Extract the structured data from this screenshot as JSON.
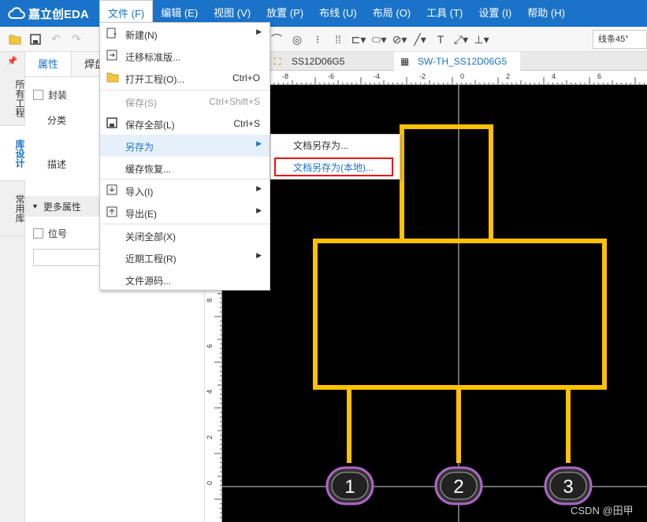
{
  "app": {
    "logo_text": "嘉立创EDA"
  },
  "menubar": {
    "items": [
      "文件 (F)",
      "编辑 (E)",
      "视图 (V)",
      "放置 (P)",
      "布线 (U)",
      "布局 (O)",
      "工具 (T)",
      "设置 (I)",
      "帮助 (H)"
    ]
  },
  "toolbar": {
    "line_angle": "线条45°"
  },
  "left_tabs": {
    "all_projects": "所有工程",
    "library_design": "库设计",
    "common_library": "常用库"
  },
  "props": {
    "tab_props": "属性",
    "tab_pad": "焊盘",
    "package_label": "封装",
    "category_label": "分类",
    "desc_label": "描述",
    "more_props": "更多属性",
    "designator_label": "位号"
  },
  "doc_tabs": {
    "tab1": "SS12D06G5",
    "tab2": "SW-TH_SS12D06G5"
  },
  "ruler": {
    "h_ticks": [
      "-8",
      "-6",
      "-4",
      "-2",
      "0",
      "2",
      "4",
      "6"
    ],
    "v_ticks": [
      "8",
      "6",
      "4",
      "2",
      "0"
    ]
  },
  "file_menu": {
    "new": "新建(N)",
    "migrate": "迁移标准版...",
    "open_project": "打开工程(O)...",
    "open_project_short": "Ctrl+O",
    "save": "保存(S)",
    "save_short": "Ctrl+Shift+S",
    "save_all": "保存全部(L)",
    "save_all_short": "Ctrl+S",
    "save_as": "另存为",
    "cache_restore": "缓存恢复...",
    "import": "导入(I)",
    "export": "导出(E)",
    "close_all": "关闭全部(X)",
    "recent": "近期工程(R)",
    "source": "文件源码..."
  },
  "save_as_menu": {
    "doc_save_as": "文档另存为...",
    "doc_save_as_local": "文档另存为(本地)..."
  },
  "pads": [
    "1",
    "2",
    "3"
  ],
  "watermark": "CSDN @田甲",
  "colors": {
    "accent": "#1a73c8",
    "outline": "#ffc000",
    "board": "#000000",
    "highlight_box": "#ee1111"
  }
}
